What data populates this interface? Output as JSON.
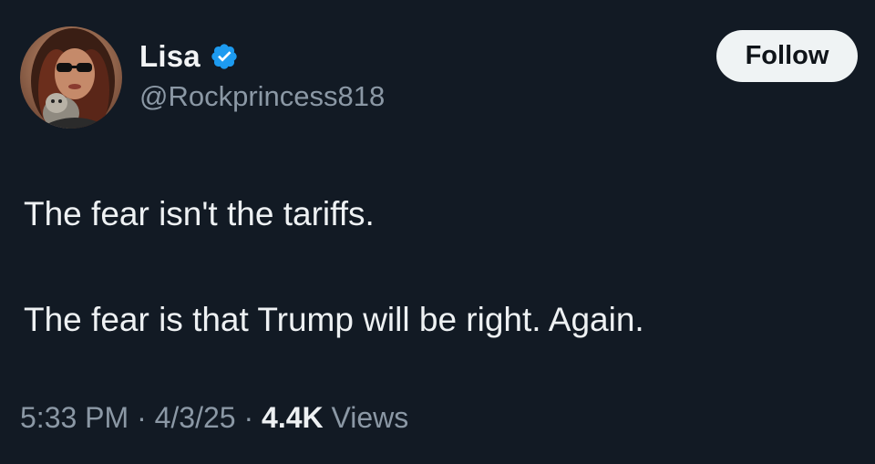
{
  "author": {
    "display_name": "Lisa",
    "handle": "@Rockprincess818",
    "verified": true,
    "avatar_icon": "profile-photo"
  },
  "follow_button": {
    "label": "Follow"
  },
  "tweet": {
    "line1": "The fear isn't the tariffs.",
    "line2": "The fear is that Trump will be right. Again."
  },
  "meta": {
    "time": "5:33 PM",
    "separator1": " · ",
    "date": "4/3/25",
    "separator2": " · ",
    "views_count": "4.4K",
    "views_label": " Views"
  },
  "colors": {
    "background": "#121a24",
    "verified_badge": "#1d9bf0",
    "follow_button_bg": "#eff3f4",
    "secondary_text": "#8b98a5"
  }
}
